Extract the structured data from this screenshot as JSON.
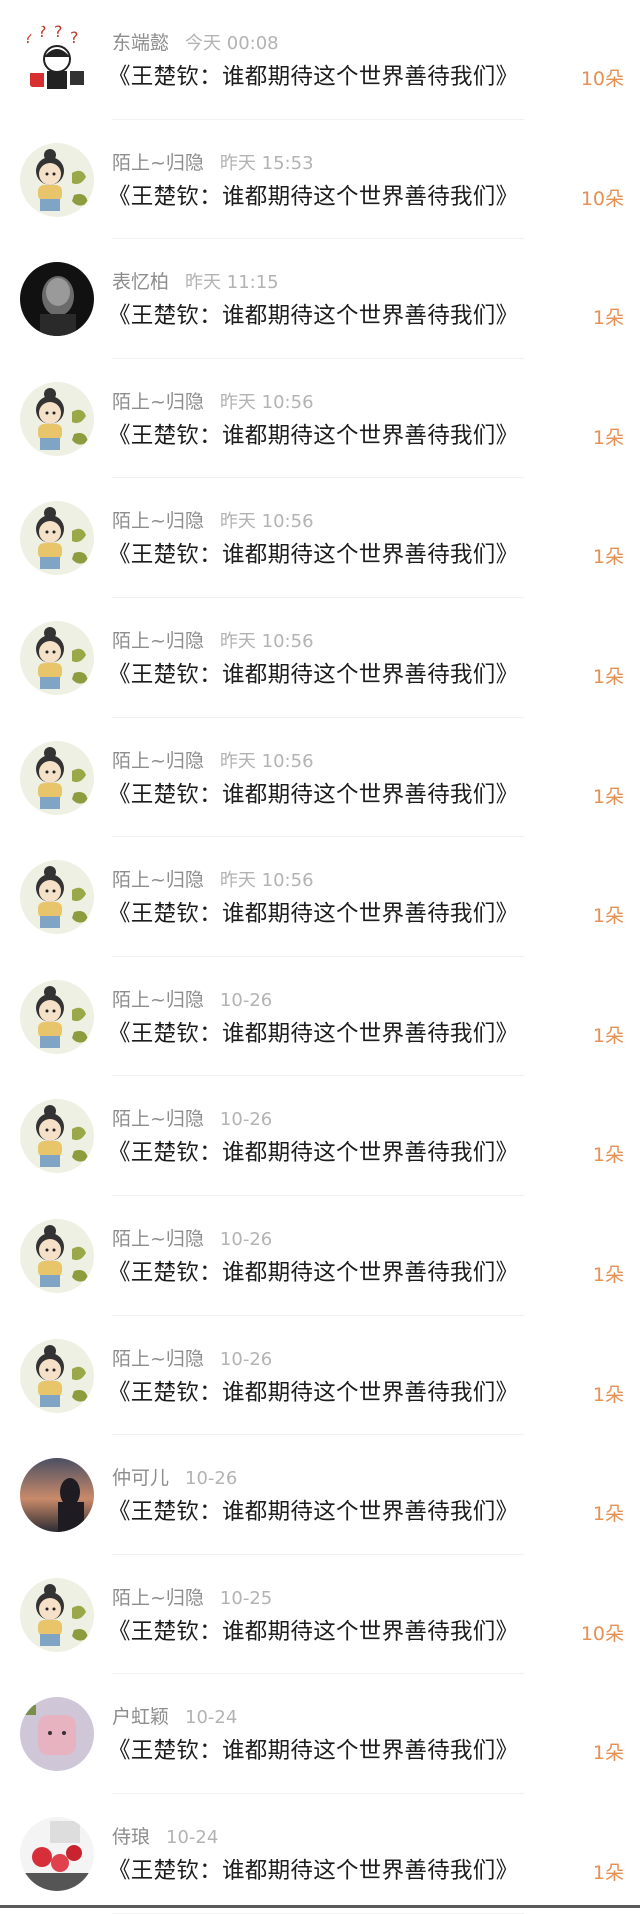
{
  "items": [
    {
      "user": "东端懿",
      "time": "今天 00:08",
      "title": "《王楚钦：谁都期待这个世界善待我们》",
      "flowers": "10朵",
      "avatar": "question-marks-avatar"
    },
    {
      "user": "陌上~归隐",
      "time": "昨天 15:53",
      "title": "《王楚钦：谁都期待这个世界善待我们》",
      "flowers": "10朵",
      "avatar": "cartoon-girl-avatar"
    },
    {
      "user": "表忆柏",
      "time": "昨天 11:15",
      "title": "《王楚钦：谁都期待这个世界善待我们》",
      "flowers": "1朵",
      "avatar": "dark-portrait-avatar"
    },
    {
      "user": "陌上~归隐",
      "time": "昨天 10:56",
      "title": "《王楚钦：谁都期待这个世界善待我们》",
      "flowers": "1朵",
      "avatar": "cartoon-girl-avatar"
    },
    {
      "user": "陌上~归隐",
      "time": "昨天 10:56",
      "title": "《王楚钦：谁都期待这个世界善待我们》",
      "flowers": "1朵",
      "avatar": "cartoon-girl-avatar"
    },
    {
      "user": "陌上~归隐",
      "time": "昨天 10:56",
      "title": "《王楚钦：谁都期待这个世界善待我们》",
      "flowers": "1朵",
      "avatar": "cartoon-girl-avatar"
    },
    {
      "user": "陌上~归隐",
      "time": "昨天 10:56",
      "title": "《王楚钦：谁都期待这个世界善待我们》",
      "flowers": "1朵",
      "avatar": "cartoon-girl-avatar"
    },
    {
      "user": "陌上~归隐",
      "time": "昨天 10:56",
      "title": "《王楚钦：谁都期待这个世界善待我们》",
      "flowers": "1朵",
      "avatar": "cartoon-girl-avatar"
    },
    {
      "user": "陌上~归隐",
      "time": "10-26",
      "title": "《王楚钦：谁都期待这个世界善待我们》",
      "flowers": "1朵",
      "avatar": "cartoon-girl-avatar"
    },
    {
      "user": "陌上~归隐",
      "time": "10-26",
      "title": "《王楚钦：谁都期待这个世界善待我们》",
      "flowers": "1朵",
      "avatar": "cartoon-girl-avatar"
    },
    {
      "user": "陌上~归隐",
      "time": "10-26",
      "title": "《王楚钦：谁都期待这个世界善待我们》",
      "flowers": "1朵",
      "avatar": "cartoon-girl-avatar"
    },
    {
      "user": "陌上~归隐",
      "time": "10-26",
      "title": "《王楚钦：谁都期待这个世界善待我们》",
      "flowers": "1朵",
      "avatar": "cartoon-girl-avatar"
    },
    {
      "user": "仲可儿",
      "time": "10-26",
      "title": "《王楚钦：谁都期待这个世界善待我们》",
      "flowers": "1朵",
      "avatar": "sunset-silhouette-avatar"
    },
    {
      "user": "陌上~归隐",
      "time": "10-25",
      "title": "《王楚钦：谁都期待这个世界善待我们》",
      "flowers": "10朵",
      "avatar": "cartoon-girl-avatar"
    },
    {
      "user": "户虹颖",
      "time": "10-24",
      "title": "《王楚钦：谁都期待这个世界善待我们》",
      "flowers": "1朵",
      "avatar": "pink-plush-avatar"
    },
    {
      "user": "侍琅",
      "time": "10-24",
      "title": "《王楚钦：谁都期待这个世界善待我们》",
      "flowers": "1朵",
      "avatar": "red-floral-avatar"
    }
  ],
  "colors": {
    "name": "#8d8d8d",
    "time": "#b3b3b3",
    "title": "#1c1c1c",
    "flowers": "#e59055",
    "divider": "#f1f1f1"
  }
}
